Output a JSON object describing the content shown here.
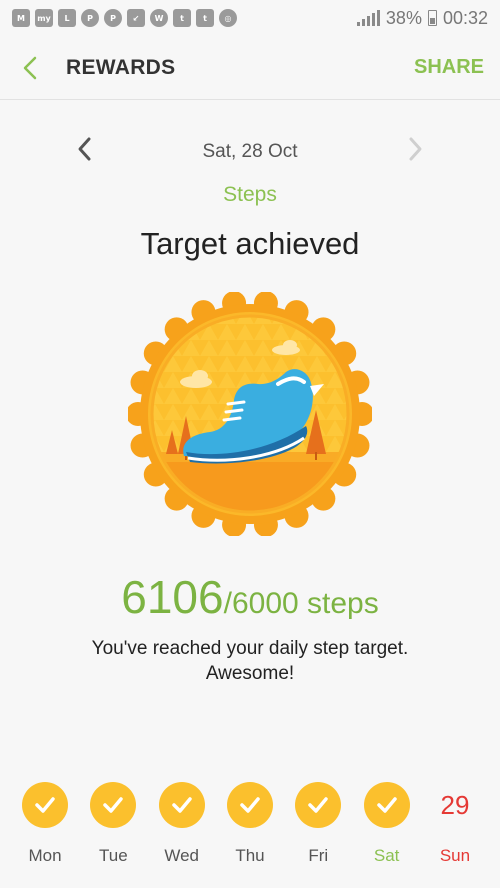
{
  "status_bar": {
    "left_icons": [
      "M",
      "my",
      "levis",
      "pinterest-icon",
      "pinterest-icon",
      "missed-call-icon",
      "whatsapp-icon",
      "twitter-icon",
      "twitter-icon",
      "alarm-icon"
    ],
    "battery": "38%",
    "time": "00:32"
  },
  "header": {
    "title": "REWARDS",
    "share_label": "SHARE"
  },
  "date_nav": {
    "date": "Sat, 28 Oct"
  },
  "reward": {
    "category": "Steps",
    "headline": "Target achieved",
    "current": "6106",
    "target_text": "/6000 steps",
    "message_line1": "You've reached your daily step target.",
    "message_line2": "Awesome!"
  },
  "week": [
    {
      "label": "Mon",
      "achieved": true
    },
    {
      "label": "Tue",
      "achieved": true
    },
    {
      "label": "Wed",
      "achieved": true
    },
    {
      "label": "Thu",
      "achieved": true
    },
    {
      "label": "Fri",
      "achieved": true
    },
    {
      "label": "Sat",
      "achieved": true,
      "selected": true
    },
    {
      "label": "Sun",
      "achieved": false,
      "number": "29"
    }
  ],
  "colors": {
    "accent_green": "#8cc152",
    "steps_green": "#7cb342",
    "badge_orange": "#f7a21b",
    "check_yellow": "#fbc02d",
    "sunday_red": "#e53935"
  }
}
